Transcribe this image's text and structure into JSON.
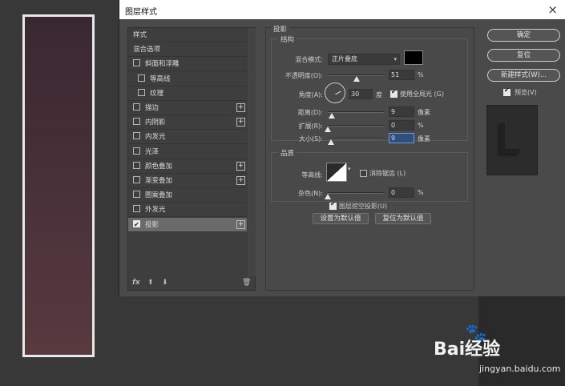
{
  "dialog": {
    "title": "图层样式",
    "close": "×"
  },
  "list": {
    "items": [
      {
        "label": "样式",
        "checkbox": false,
        "plus": false,
        "indent": false,
        "selected": false
      },
      {
        "label": "混合选项",
        "checkbox": false,
        "plus": false,
        "indent": false,
        "selected": false
      },
      {
        "label": "斜面和浮雕",
        "checkbox": true,
        "checked": false,
        "plus": false,
        "indent": false,
        "selected": false
      },
      {
        "label": "等高线",
        "checkbox": true,
        "checked": false,
        "plus": false,
        "indent": true,
        "selected": false
      },
      {
        "label": "纹理",
        "checkbox": true,
        "checked": false,
        "plus": false,
        "indent": true,
        "selected": false
      },
      {
        "label": "描边",
        "checkbox": true,
        "checked": false,
        "plus": true,
        "indent": false,
        "selected": false
      },
      {
        "label": "内阴影",
        "checkbox": true,
        "checked": false,
        "plus": true,
        "indent": false,
        "selected": false
      },
      {
        "label": "内发光",
        "checkbox": true,
        "checked": false,
        "plus": false,
        "indent": false,
        "selected": false
      },
      {
        "label": "光泽",
        "checkbox": true,
        "checked": false,
        "plus": false,
        "indent": false,
        "selected": false
      },
      {
        "label": "颜色叠加",
        "checkbox": true,
        "checked": false,
        "plus": true,
        "indent": false,
        "selected": false
      },
      {
        "label": "渐变叠加",
        "checkbox": true,
        "checked": false,
        "plus": true,
        "indent": false,
        "selected": false
      },
      {
        "label": "图案叠加",
        "checkbox": true,
        "checked": false,
        "plus": false,
        "indent": false,
        "selected": false
      },
      {
        "label": "外发光",
        "checkbox": true,
        "checked": false,
        "plus": false,
        "indent": false,
        "selected": false
      },
      {
        "label": "投影",
        "checkbox": true,
        "checked": true,
        "plus": true,
        "indent": false,
        "selected": true
      }
    ],
    "fx": "fx",
    "up": "⬆",
    "down": "⬇",
    "trash": "🗑"
  },
  "shadow": {
    "section_title": "投影",
    "structure_title": "结构",
    "blend_mode_label": "混合模式:",
    "blend_mode_value": "正片叠底",
    "opacity_label": "不透明度(O):",
    "opacity_value": "51",
    "opacity_pct": 51,
    "angle_label": "角度(A):",
    "angle_value": "30",
    "angle_unit": "度",
    "global_light_label": "使用全局光 (G)",
    "distance_label": "距离(D):",
    "distance_value": "9",
    "distance_unit": "像素",
    "spread_label": "扩展(R):",
    "spread_value": "0",
    "size_label": "大小(S):",
    "size_value": "9",
    "size_unit": "像素",
    "quality_title": "品质",
    "contour_label": "等高线:",
    "antialias_label": "消除锯齿 (L)",
    "noise_label": "杂色(N):",
    "noise_value": "0",
    "knockout_label": "图层挖空投影(U)",
    "set_default": "设置为默认值",
    "reset_default": "复位为默认值",
    "percent": "%",
    "shadow_color": "#000000"
  },
  "buttons": {
    "ok": "确定",
    "reset": "复位",
    "new_style": "新建样式(W)...",
    "preview": "预览(V)"
  },
  "watermark": {
    "brand": "Bai经验",
    "url": "jingyan.baidu.com"
  }
}
